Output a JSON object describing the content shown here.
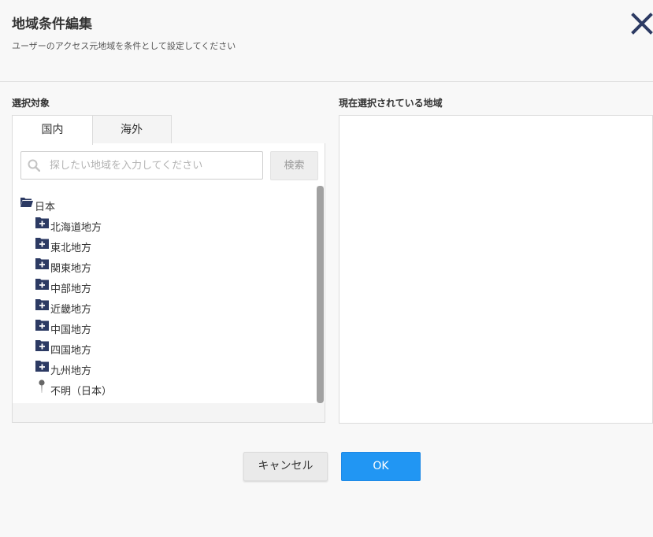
{
  "dialog": {
    "title": "地域条件編集",
    "subtitle": "ユーザーのアクセス元地域を条件として設定してください"
  },
  "left": {
    "section_label": "選択対象",
    "tabs": [
      {
        "label": "国内",
        "active": true
      },
      {
        "label": "海外",
        "active": false
      }
    ],
    "search": {
      "placeholder": "探したい地域を入力してください",
      "value": "",
      "button_label": "検索"
    },
    "tree": {
      "root": {
        "label": "日本",
        "icon": "folder-open-icon"
      },
      "children": [
        {
          "label": "北海道地方",
          "icon": "folder-plus-icon"
        },
        {
          "label": "東北地方",
          "icon": "folder-plus-icon"
        },
        {
          "label": "関東地方",
          "icon": "folder-plus-icon"
        },
        {
          "label": "中部地方",
          "icon": "folder-plus-icon"
        },
        {
          "label": "近畿地方",
          "icon": "folder-plus-icon"
        },
        {
          "label": "中国地方",
          "icon": "folder-plus-icon"
        },
        {
          "label": "四国地方",
          "icon": "folder-plus-icon"
        },
        {
          "label": "九州地方",
          "icon": "folder-plus-icon"
        },
        {
          "label": "不明（日本）",
          "icon": "map-pin-icon"
        }
      ]
    }
  },
  "right": {
    "section_label": "現在選択されている地域",
    "selected": []
  },
  "footer": {
    "cancel_label": "キャンセル",
    "ok_label": "OK"
  },
  "colors": {
    "accent": "#2196f3",
    "folder_icon": "#2c3a63",
    "background": "#f8f8f8"
  }
}
